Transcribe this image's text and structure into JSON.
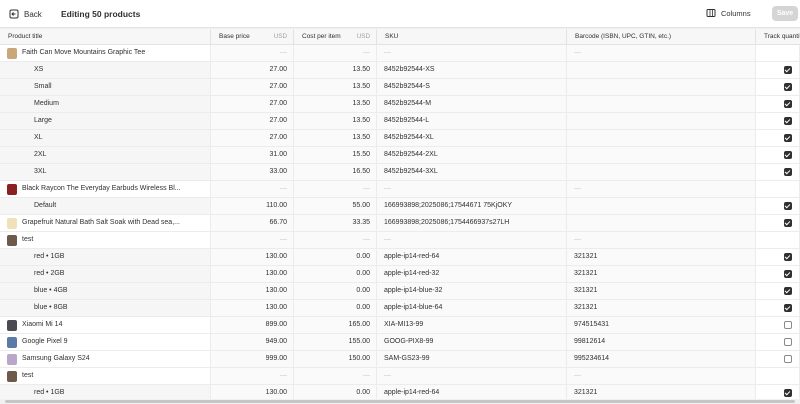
{
  "header": {
    "back_label": "Back",
    "title": "Editing 50 products",
    "columns_label": "Columns",
    "save_label": "Save"
  },
  "columns": {
    "product_title": "Product title",
    "base_price": "Base price",
    "base_price_unit": "USD",
    "cost_per_item": "Cost per item",
    "cost_unit": "USD",
    "sku": "SKU",
    "barcode": "Barcode (ISBN, UPC, GTIN, etc.)",
    "track_quantity": "Track quantity"
  },
  "rows": [
    {
      "kind": "parent",
      "title": "Faith Can Move Mountains Graphic Tee",
      "thumb_color": "#c9a77a",
      "base": "—",
      "cost": "—",
      "sku": "—",
      "barcode": "—",
      "track": null
    },
    {
      "kind": "variant",
      "title": "XS",
      "base": "27.00",
      "cost": "13.50",
      "sku": "8452b92544-XS",
      "barcode": "",
      "track": true
    },
    {
      "kind": "variant",
      "title": "Small",
      "base": "27.00",
      "cost": "13.50",
      "sku": "8452b92544-S",
      "barcode": "",
      "track": true
    },
    {
      "kind": "variant",
      "title": "Medium",
      "base": "27.00",
      "cost": "13.50",
      "sku": "8452b92544-M",
      "barcode": "",
      "track": true
    },
    {
      "kind": "variant",
      "title": "Large",
      "base": "27.00",
      "cost": "13.50",
      "sku": "8452b92544-L",
      "barcode": "",
      "track": true
    },
    {
      "kind": "variant",
      "title": "XL",
      "base": "27.00",
      "cost": "13.50",
      "sku": "8452b92544-XL",
      "barcode": "",
      "track": true
    },
    {
      "kind": "variant",
      "title": "2XL",
      "base": "31.00",
      "cost": "15.50",
      "sku": "8452b92544-2XL",
      "barcode": "",
      "track": true
    },
    {
      "kind": "variant",
      "title": "3XL",
      "base": "33.00",
      "cost": "16.50",
      "sku": "8452b92544-3XL",
      "barcode": "",
      "track": true
    },
    {
      "kind": "parent",
      "title": "Black Raycon The Everyday Earbuds Wireless Bl...",
      "thumb_color": "#8a1f24",
      "base": "—",
      "cost": "—",
      "sku": "—",
      "barcode": "—",
      "track": null
    },
    {
      "kind": "variant",
      "title": "Default",
      "base": "110.00",
      "cost": "55.00",
      "sku": "166993898;2025086;17544671 75KjOKY",
      "barcode": "",
      "track": true
    },
    {
      "kind": "product",
      "title": "Grapefruit Natural Bath Salt Soak with Dead sea,...",
      "thumb_color": "#f0e2b8",
      "base": "66.70",
      "cost": "33.35",
      "sku": "166993898;2025086;1754466937s27LH",
      "barcode": "",
      "track": true
    },
    {
      "kind": "parent",
      "title": "test",
      "thumb_color": "#6e5a4a",
      "base": "—",
      "cost": "—",
      "sku": "—",
      "barcode": "—",
      "track": null
    },
    {
      "kind": "variant",
      "title": "red • 1GB",
      "base": "130.00",
      "cost": "0.00",
      "sku": "apple-ip14-red-64",
      "barcode": "321321",
      "track": true
    },
    {
      "kind": "variant",
      "title": "red • 2GB",
      "base": "130.00",
      "cost": "0.00",
      "sku": "apple-ip14-red-32",
      "barcode": "321321",
      "track": true
    },
    {
      "kind": "variant",
      "title": "blue • 4GB",
      "base": "130.00",
      "cost": "0.00",
      "sku": "apple-ip14-blue-32",
      "barcode": "321321",
      "track": true
    },
    {
      "kind": "variant",
      "title": "blue • 8GB",
      "base": "130.00",
      "cost": "0.00",
      "sku": "apple-ip14-blue-64",
      "barcode": "321321",
      "track": true
    },
    {
      "kind": "product",
      "title": "Xiaomi Mi 14",
      "thumb_color": "#4a4a52",
      "base": "899.00",
      "cost": "165.00",
      "sku": "XIA-MI13-99",
      "barcode": "974515431",
      "track": false
    },
    {
      "kind": "product",
      "title": "Google Pixel 9",
      "thumb_color": "#5b7aa8",
      "base": "949.00",
      "cost": "155.00",
      "sku": "GOOG-PIX8-99",
      "barcode": "99812614",
      "track": false
    },
    {
      "kind": "product",
      "title": "Samsung Galaxy S24",
      "thumb_color": "#b9a6c8",
      "base": "999.00",
      "cost": "150.00",
      "sku": "SAM-GS23-99",
      "barcode": "995234614",
      "track": false
    },
    {
      "kind": "parent",
      "title": "test",
      "thumb_color": "#6e5a4a",
      "base": "—",
      "cost": "—",
      "sku": "—",
      "barcode": "—",
      "track": null
    },
    {
      "kind": "variant",
      "title": "red • 1GB",
      "base": "130.00",
      "cost": "0.00",
      "sku": "apple-ip14-red-64",
      "barcode": "321321",
      "track": true
    }
  ]
}
